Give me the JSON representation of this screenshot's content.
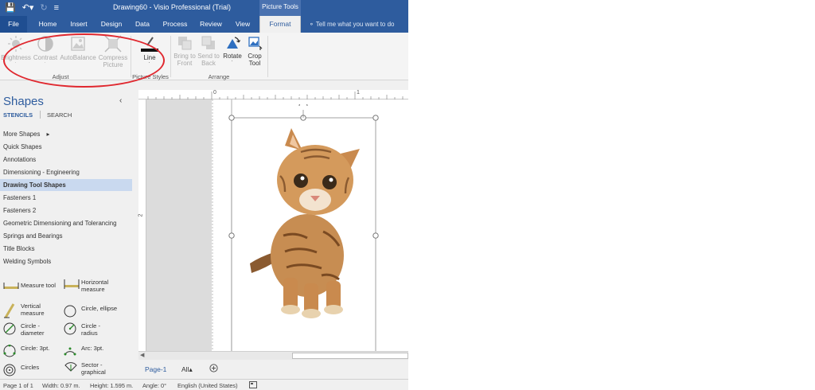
{
  "window": {
    "title": "Drawing60 - Visio Professional (Trial)",
    "context_header": "Picture Tools"
  },
  "quick_access": {
    "save_icon": "save-icon",
    "undo_icon": "undo-icon",
    "redo_icon": "redo-icon",
    "customize_icon": "customize-qat-icon"
  },
  "tabs": [
    {
      "label": "File"
    },
    {
      "label": "Home"
    },
    {
      "label": "Insert"
    },
    {
      "label": "Design"
    },
    {
      "label": "Data"
    },
    {
      "label": "Process"
    },
    {
      "label": "Review"
    },
    {
      "label": "View"
    },
    {
      "label": "Format"
    }
  ],
  "tell_me": "Tell me what you want to do",
  "ribbon": {
    "adjust": {
      "label": "Adjust",
      "brightness": "Brightness",
      "contrast": "Contrast",
      "autobalance": "AutoBalance",
      "compress_line1": "Compress",
      "compress_line2": "Picture"
    },
    "picture_styles": {
      "label": "Picture Styles",
      "line": "Line"
    },
    "arrange": {
      "label": "Arrange",
      "bring_line1": "Bring to",
      "bring_line2": "Front",
      "send_line1": "Send to",
      "send_line2": "Back",
      "rotate": "Rotate",
      "crop_line1": "Crop",
      "crop_line2": "Tool"
    }
  },
  "shapes_panel": {
    "title": "Shapes",
    "tab_stencils": "STENCILS",
    "tab_search": "SEARCH",
    "more_shapes": "More Shapes",
    "items": [
      {
        "label": "Quick Shapes"
      },
      {
        "label": "Annotations"
      },
      {
        "label": "Dimensioning - Engineering"
      },
      {
        "label": "Drawing Tool Shapes"
      },
      {
        "label": "Fasteners 1"
      },
      {
        "label": "Fasteners 2"
      },
      {
        "label": "Geometric Dimensioning and Tolerancing"
      },
      {
        "label": "Springs and Bearings"
      },
      {
        "label": "Title Blocks"
      },
      {
        "label": "Welding Symbols"
      }
    ],
    "selected_index": 3,
    "stencils": [
      {
        "l1": "Measure tool",
        "l2": ""
      },
      {
        "l1": "Horizontal",
        "l2": "measure"
      },
      {
        "l1": "Vertical",
        "l2": "measure"
      },
      {
        "l1": "Circle, ellipse",
        "l2": ""
      },
      {
        "l1": "Circle -",
        "l2": "diameter"
      },
      {
        "l1": "Circle -",
        "l2": "radius"
      },
      {
        "l1": "Circle: 3pt.",
        "l2": ""
      },
      {
        "l1": "Arc: 3pt.",
        "l2": ""
      },
      {
        "l1": "Circles",
        "l2": ""
      },
      {
        "l1": "Sector -",
        "l2": "graphical"
      }
    ]
  },
  "rulers": {
    "top_labels": [
      "0",
      "1"
    ],
    "left_label": "2"
  },
  "page_tabs": {
    "page": "Page-1",
    "all": "All"
  },
  "status": {
    "page": "Page 1 of 1",
    "width": "Width: 0.97 m.",
    "height": "Height: 1.595 m.",
    "angle": "Angle: 0°",
    "language": "English (United States)"
  },
  "colors": {
    "accent": "#2e5c9e",
    "highlight_oval": "#e0282f"
  }
}
